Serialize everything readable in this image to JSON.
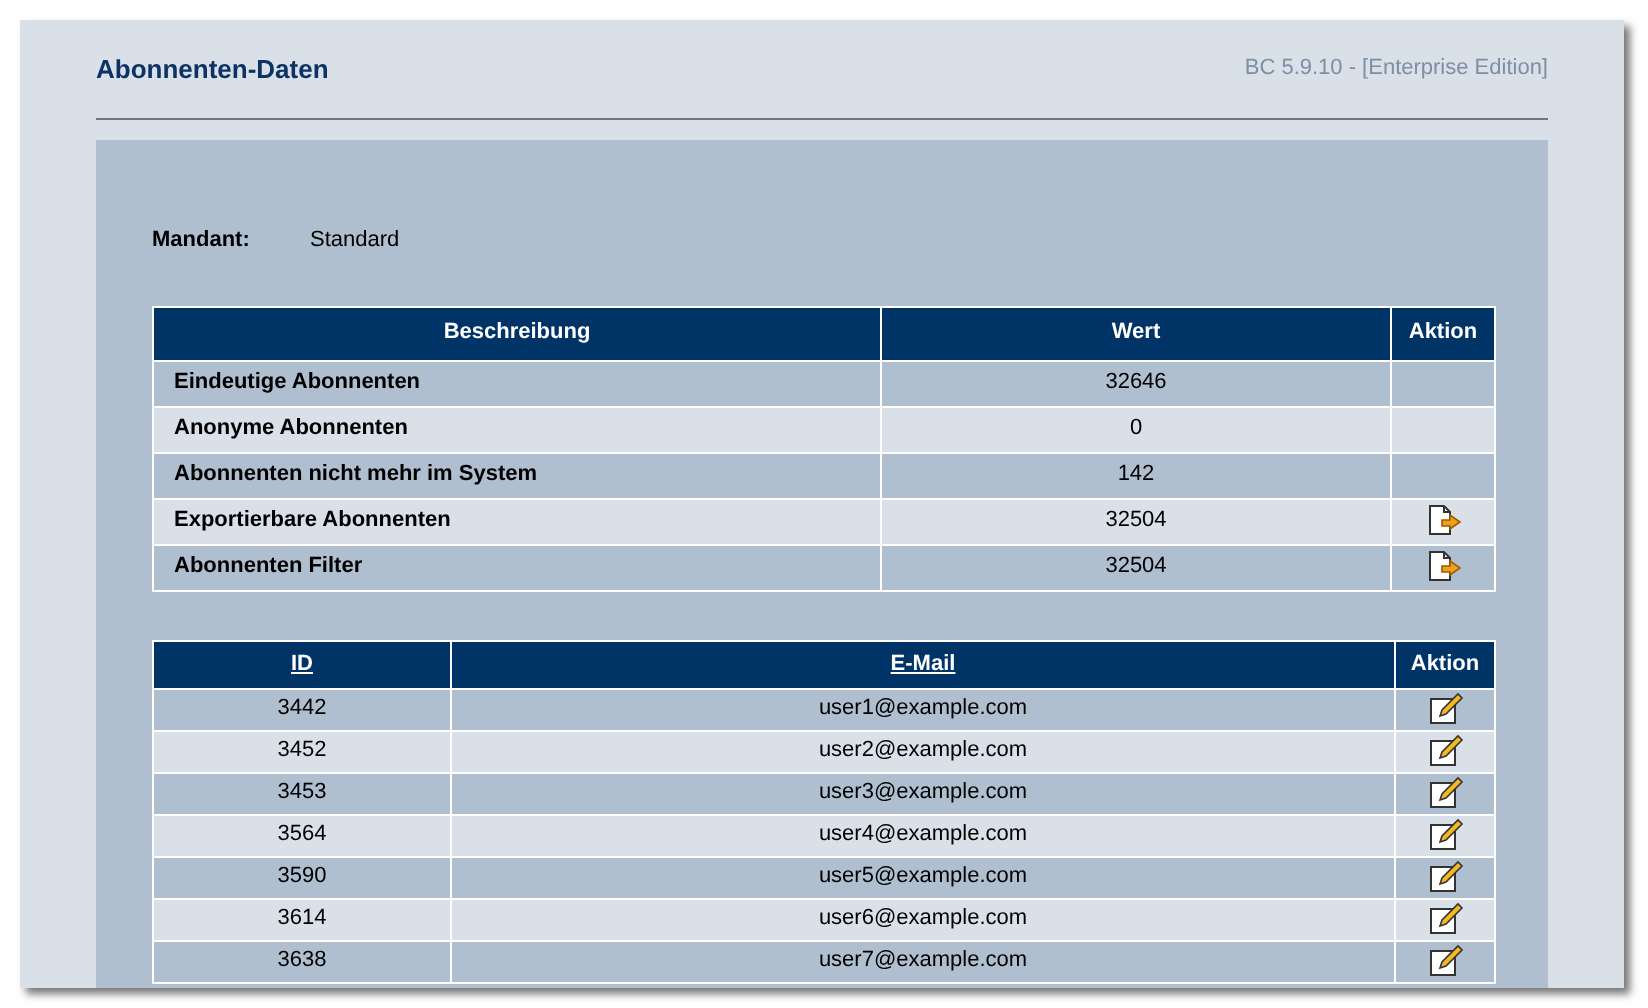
{
  "page": {
    "title": "Abonnenten-Daten",
    "version": "BC 5.9.10 - [Enterprise Edition]"
  },
  "client": {
    "label": "Mandant:",
    "value": "Standard"
  },
  "stats_table": {
    "columns": [
      "Beschreibung",
      "Wert",
      "Aktion"
    ],
    "rows": [
      {
        "description": "Eindeutige Abonnenten",
        "value": "32646"
      },
      {
        "description": "Anonyme Abonnenten",
        "value": "0"
      },
      {
        "description": "Abonnenten nicht mehr im System",
        "value": "142"
      },
      {
        "description": "Exportierbare Abonnenten",
        "value": "32504",
        "kind": "export"
      },
      {
        "description": "Abonnenten Filter",
        "value": "32504",
        "kind": "export"
      }
    ]
  },
  "subscribers_table": {
    "columns": [
      "ID",
      "E-Mail",
      "Aktion"
    ],
    "rows": [
      {
        "id": "3442",
        "email": "user1@example.com",
        "kind": "edit"
      },
      {
        "id": "3452",
        "email": "user2@example.com",
        "kind": "edit"
      },
      {
        "id": "3453",
        "email": "user3@example.com",
        "kind": "edit"
      },
      {
        "id": "3564",
        "email": "user4@example.com",
        "kind": "edit"
      },
      {
        "id": "3590",
        "email": "user5@example.com",
        "kind": "edit"
      },
      {
        "id": "3614",
        "email": "user6@example.com",
        "kind": "edit"
      },
      {
        "id": "3638",
        "email": "user7@example.com",
        "kind": "edit"
      }
    ]
  }
}
